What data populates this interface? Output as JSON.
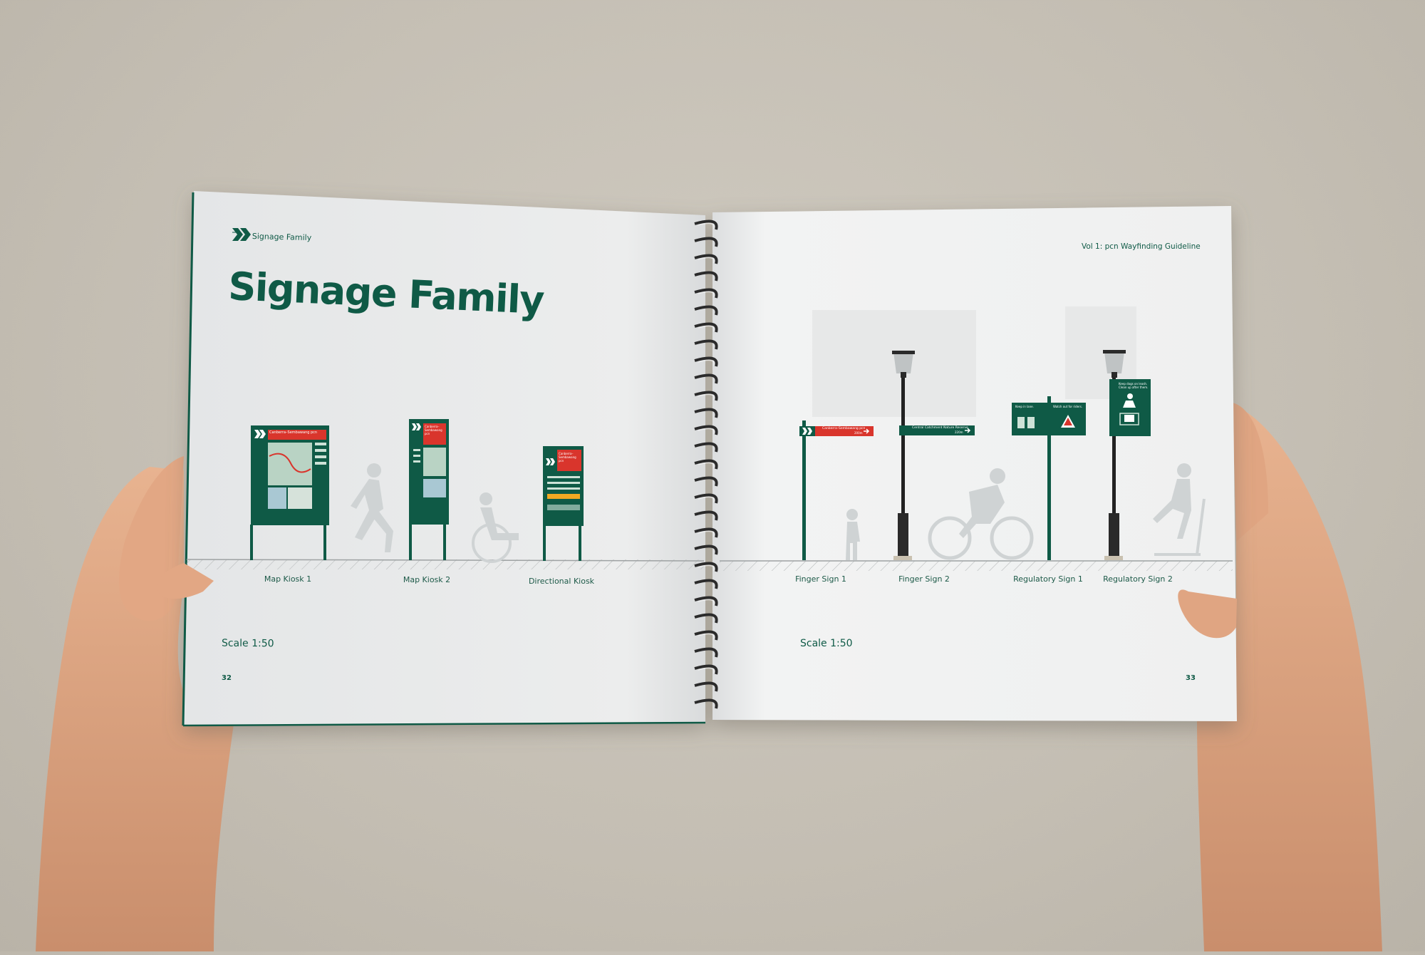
{
  "book": {
    "left_page": {
      "header_label": "Signage Family",
      "title": "Signage Family",
      "scale": "Scale 1:50",
      "page_number": "32",
      "captions": [
        "Map Kiosk 1",
        "Map Kiosk 2",
        "Directional Kiosk"
      ]
    },
    "right_page": {
      "header_label": "Vol 1: pcn Wayfinding Guideline",
      "scale": "Scale 1:50",
      "page_number": "33",
      "captions": [
        "Finger Sign 1",
        "Finger Sign 2",
        "Regulatory Sign 1",
        "Regulatory Sign 2"
      ]
    }
  },
  "signs": {
    "kiosk1_heading": "Canberra–Sembawang pcn",
    "kiosk2_heading": "Canberra–Sembawang pcn",
    "directional_heading": "Canberra–Sembawang pcn",
    "finger1_text": "Canberra–Sembawang pcn",
    "finger1_distance": "200m",
    "finger2_text": "Central Catchment Nature Reserve",
    "finger2_distance": "220m",
    "reg1_left": "Keep in lane.",
    "reg1_right": "Watch out for riders.",
    "reg2_text": "Keep dogs on leash. Clean up after them."
  },
  "colors": {
    "brand_green": "#0f5a46",
    "accent_red": "#d9352c",
    "page_white": "#eeeff0",
    "background": "#c7c1b6"
  }
}
